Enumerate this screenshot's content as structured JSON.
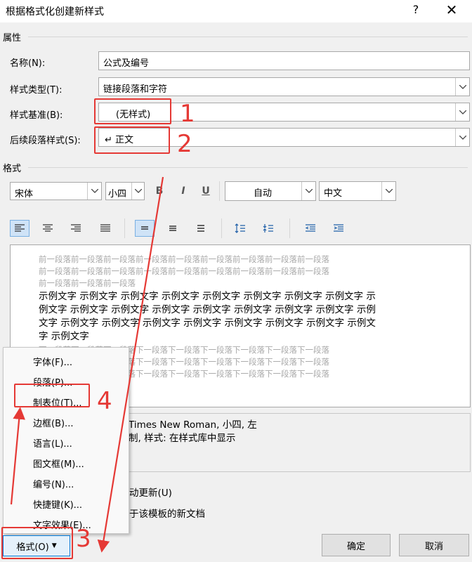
{
  "window": {
    "title": "根据格式化创建新样式",
    "help": "?",
    "close": "✕"
  },
  "properties": {
    "section": "属性",
    "name_label": "名称(N):",
    "name_value": "公式及编号",
    "type_label": "样式类型(T):",
    "type_value": "链接段落和字符",
    "base_label": "样式基准(B):",
    "base_value": "(无样式)",
    "next_label": "后续段落样式(S):",
    "next_value": "↵ 正文"
  },
  "format": {
    "section": "格式",
    "font": "宋体",
    "size": "小四",
    "bold": "B",
    "italic": "I",
    "underline": "U",
    "color": "自动",
    "lang": "中文"
  },
  "preview": {
    "prev_lines": [
      "前一段落前一段落前一段落前一段落前一段落前一段落前一段落前一段落前一段落",
      "前一段落前一段落前一段落前一段落前一段落前一段落前一段落前一段落前一段落",
      "前一段落前一段落前一段落"
    ],
    "sample_lines": [
      "示例文字 示例文字 示例文字 示例文字 示例文字 示例文字 示例文字 示例文字 示",
      "例文字 示例文字 示例文字 示例文字 示例文字 示例文字 示例文字 示例文字 示例",
      "文字 示例文字 示例文字 示例文字 示例文字 示例文字 示例文字 示例文字 示例文",
      "字 示例文字"
    ],
    "next_lines": [
      "下一段落下一段落下一段落下一段落下一段落下一段落下一段落下一段落下一段落",
      "下一段落下一段落下一段落下一段落下一段落下一段落下一段落下一段落下一段落",
      "下一段落下一段落下一段落下一段落下一段落下一段落下一段落下一段落下一段落"
    ]
  },
  "description": {
    "line1": "Times New Roman, 小四, 左",
    "line2": "制, 样式: 在样式库中显示"
  },
  "options": {
    "auto_update": "动更新(U)",
    "template_docs": "于该模板的新文档"
  },
  "menu": {
    "items": [
      "字体(F)...",
      "段落(P)...",
      "制表位(T)...",
      "边框(B)...",
      "语言(L)...",
      "图文框(M)...",
      "编号(N)...",
      "快捷键(K)...",
      "文字效果(E)..."
    ]
  },
  "buttons": {
    "format": "格式(O)",
    "ok": "确定",
    "cancel": "取消"
  },
  "annotations": {
    "n1": "1",
    "n2": "2",
    "n3": "3",
    "n4": "4",
    "color": "#e53935"
  }
}
